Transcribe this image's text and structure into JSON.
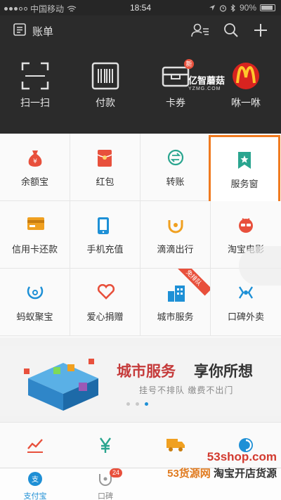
{
  "status_bar": {
    "carrier": "中国移动",
    "time": "18:54",
    "battery": "90%",
    "battery_level": 0.9
  },
  "header": {
    "title": "账单"
  },
  "quick_actions": [
    {
      "label": "扫一扫",
      "icon": "scan-icon"
    },
    {
      "label": "付款",
      "icon": "barcode-icon"
    },
    {
      "label": "卡券",
      "icon": "card-wallet-icon",
      "badge": "新"
    },
    {
      "label": "咻一咻",
      "icon": "mcdonalds-logo-icon"
    }
  ],
  "watermark_top": {
    "text": "亿智蘑菇",
    "sub": "YZMG.COM"
  },
  "grid": [
    {
      "label": "余额宝",
      "icon": "money-bag-icon",
      "color": "#e8503c"
    },
    {
      "label": "红包",
      "icon": "red-envelope-icon",
      "color": "#e8503c"
    },
    {
      "label": "转账",
      "icon": "transfer-icon",
      "color": "#2aa58f"
    },
    {
      "label": "服务窗",
      "icon": "bookmark-star-icon",
      "color": "#2aa58f",
      "highlighted": true
    },
    {
      "label": "信用卡还款",
      "icon": "credit-card-icon",
      "color": "#f0a020"
    },
    {
      "label": "手机充值",
      "icon": "phone-icon",
      "color": "#1e90d6"
    },
    {
      "label": "滴滴出行",
      "icon": "didi-icon",
      "color": "#f0a020"
    },
    {
      "label": "淘宝电影",
      "icon": "movie-icon",
      "color": "#e8503c"
    },
    {
      "label": "蚂蚁聚宝",
      "icon": "ant-fortune-icon",
      "color": "#1e90d6"
    },
    {
      "label": "爱心捐赠",
      "icon": "heart-icon",
      "color": "#e8503c"
    },
    {
      "label": "城市服务",
      "icon": "city-icon",
      "color": "#1e90d6",
      "ribbon": "免排队"
    },
    {
      "label": "口碑外卖",
      "icon": "takeout-icon",
      "color": "#1e90d6"
    }
  ],
  "banner": {
    "title_red": "城市服务",
    "title_dark": "享你所想",
    "subtitle": "挂号不排队 缴费不出门"
  },
  "tabs": [
    {
      "label": "支付宝",
      "icon": "alipay-icon",
      "active": true
    },
    {
      "label": "口碑",
      "icon": "koubei-icon",
      "badge": "24"
    }
  ],
  "site_watermark": {
    "line1": "53shop.com",
    "line2_red": "53货源网",
    "line2_dark": "淘宝开店货源"
  },
  "colors": {
    "accent": "#1e8fd5",
    "highlight_border": "#f07a1f",
    "header_bg": "#2b2b2b"
  }
}
